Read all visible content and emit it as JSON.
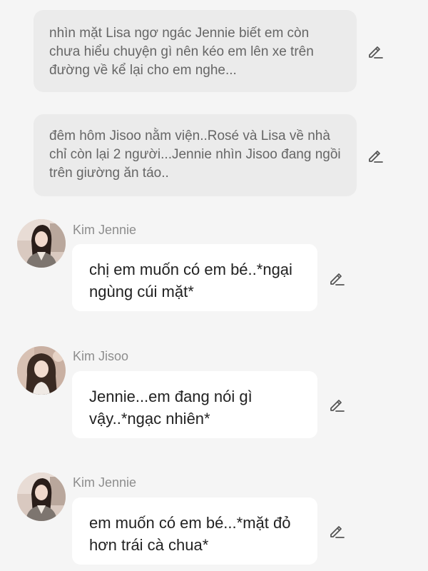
{
  "narrations": [
    {
      "text": "nhìn mặt Lisa ngơ ngác Jennie biết em còn chưa hiểu chuyện gì nên kéo em lên xe trên đường về kể lại cho em nghe..."
    },
    {
      "text": "đêm hôm Jisoo nằm viện..Rosé và Lisa về nhà chỉ còn lại 2 người...Jennie nhìn Jisoo đang ngồi trên giường ăn táo.."
    }
  ],
  "messages": [
    {
      "speaker": "Kim Jennie",
      "text": "chị em muốn có em bé..*ngại ngùng cúi mặt*"
    },
    {
      "speaker": "Kim Jisoo",
      "text": "Jennie...em đang nói gì vậy..*ngạc nhiên*"
    },
    {
      "speaker": "Kim Jennie",
      "text": "em muốn có em bé...*mặt đỏ hơn trái cà chua*"
    }
  ],
  "icons": {
    "edit": "pencil-edit-icon"
  },
  "colors": {
    "background": "#f5f5f5",
    "narration_bg": "#ebebeb",
    "bubble_bg": "#ffffff",
    "speaker_text": "#8d8d8d"
  }
}
